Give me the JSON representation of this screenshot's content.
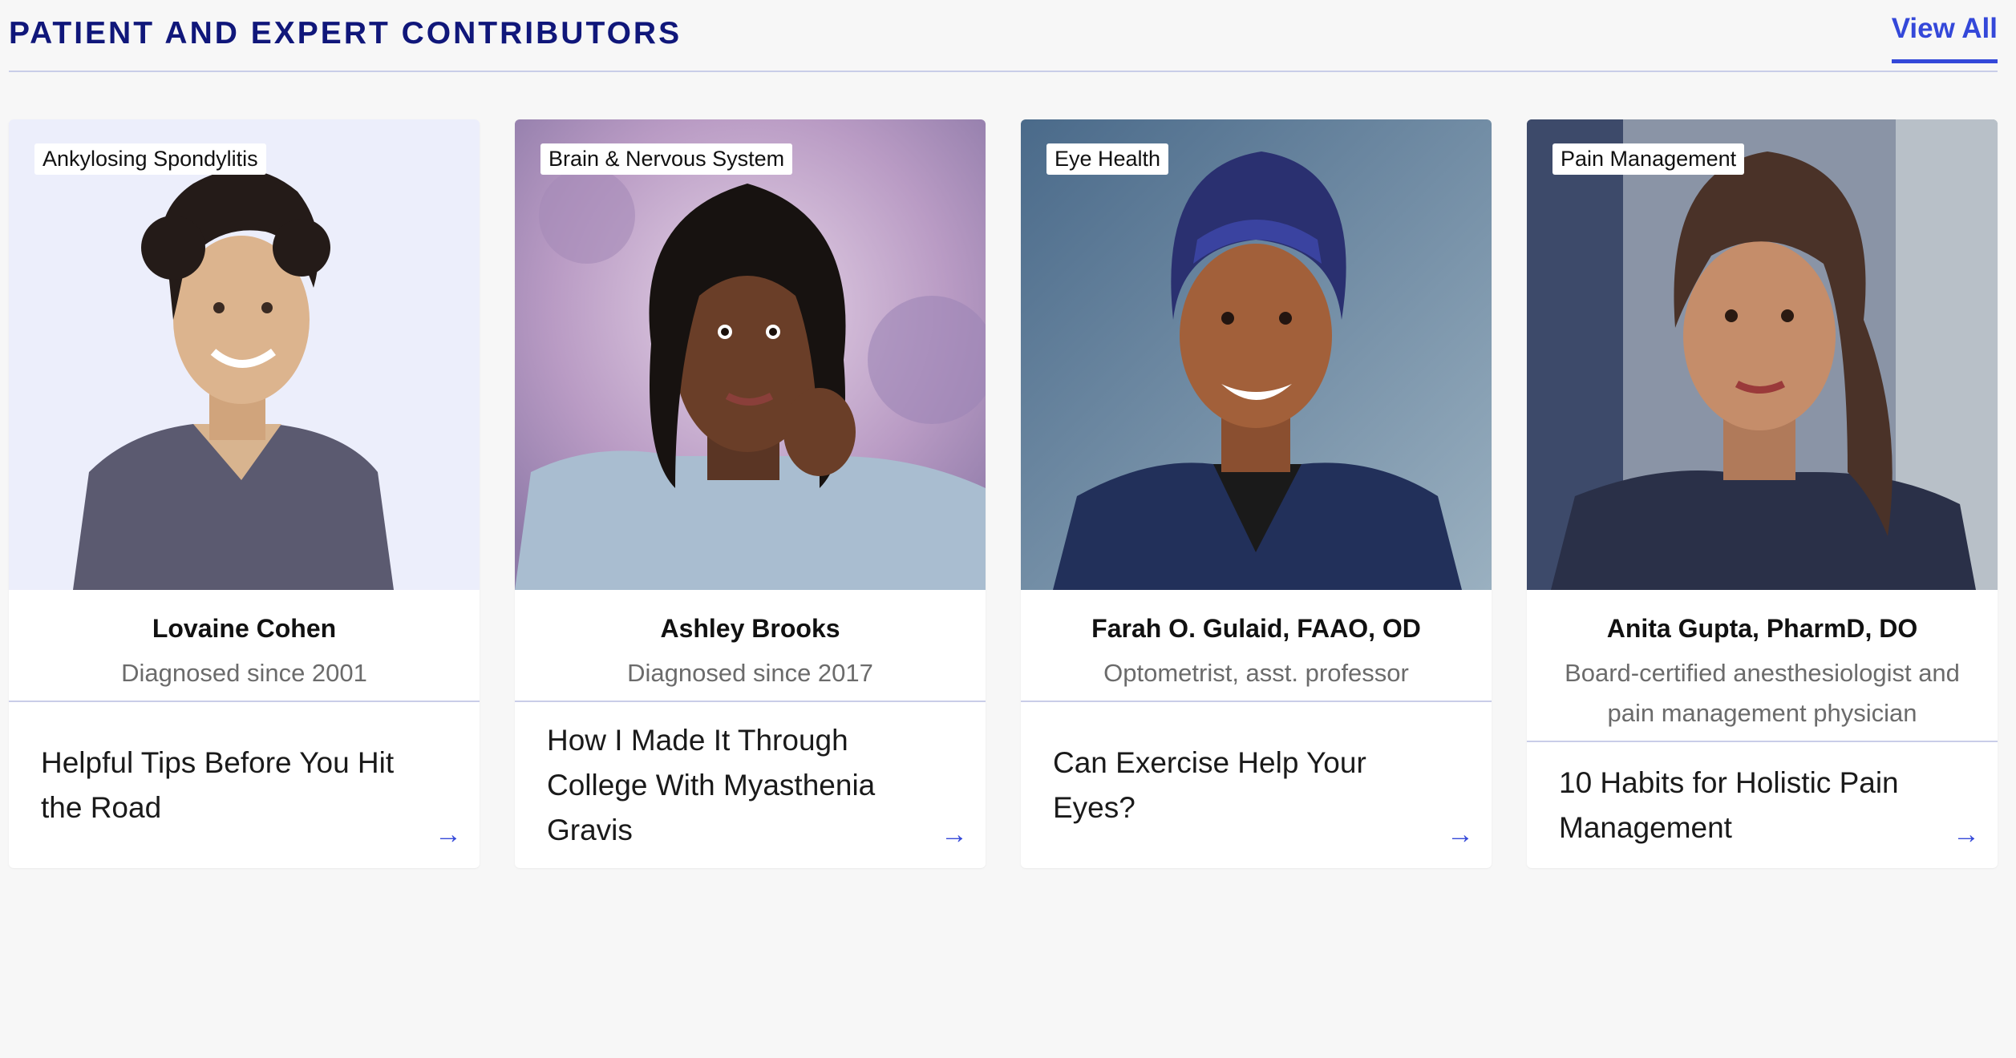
{
  "section": {
    "title": "PATIENT AND EXPERT CONTRIBUTORS",
    "view_all": "View All"
  },
  "cards": [
    {
      "tag": "Ankylosing Spondylitis",
      "name": "Lovaine Cohen",
      "desc": "Diagnosed since 2001",
      "article": "Helpful Tips Before You Hit the Road",
      "arrow_icon": "arrow-right-icon"
    },
    {
      "tag": "Brain & Nervous System",
      "name": "Ashley Brooks",
      "desc": "Diagnosed since 2017",
      "article": "How I Made It Through College With Myasthenia Gravis",
      "arrow_icon": "arrow-right-icon"
    },
    {
      "tag": "Eye Health",
      "name": "Farah O. Gulaid, FAAO, OD",
      "desc": "Optometrist, asst. professor",
      "article": "Can Exercise Help Your Eyes?",
      "arrow_icon": "arrow-right-icon"
    },
    {
      "tag": "Pain Management",
      "name": "Anita Gupta, PharmD, DO",
      "desc": "Board-certified anesthesiologist and pain management physician",
      "article": "10 Habits for Holistic Pain Management",
      "arrow_icon": "arrow-right-icon"
    }
  ],
  "colors": {
    "accent": "#3448d9",
    "title": "#10177a",
    "divider": "#c9cde8",
    "background": "#f7f7f7"
  }
}
